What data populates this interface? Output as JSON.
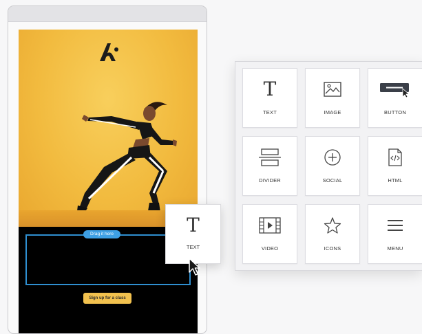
{
  "email_preview": {
    "drop_zone_label": "Drag it here",
    "cta_label": "Sign up for a class",
    "logo": "brand-logo-icon",
    "hero_image": "sprinting-woman-photo"
  },
  "blocks_panel": {
    "tiles": [
      {
        "label": "TEXT",
        "icon": "text-icon"
      },
      {
        "label": "IMAGE",
        "icon": "image-icon"
      },
      {
        "label": "BUTTON",
        "icon": "button-icon"
      },
      {
        "label": "DIVIDER",
        "icon": "divider-icon"
      },
      {
        "label": "SOCIAL",
        "icon": "social-icon"
      },
      {
        "label": "HTML",
        "icon": "html-icon"
      },
      {
        "label": "VIDEO",
        "icon": "video-icon"
      },
      {
        "label": "ICONS",
        "icon": "star-icon"
      },
      {
        "label": "MENU",
        "icon": "menu-icon"
      }
    ]
  },
  "dragging_tile": {
    "label": "TEXT",
    "icon": "text-icon"
  },
  "colors": {
    "accent_blue": "#2f8fd0",
    "hero_yellow": "#f2bb3f",
    "cta_yellow": "#f2c14e"
  }
}
